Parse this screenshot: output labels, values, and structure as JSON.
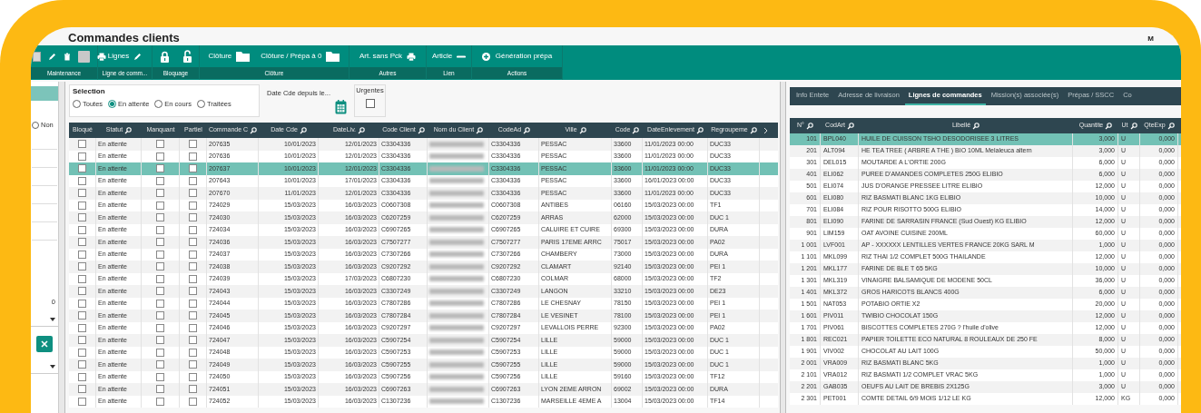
{
  "window": {
    "title": "Commandes clients",
    "user": "M"
  },
  "ribbon": {
    "groups": [
      {
        "label": "Maintenance"
      },
      {
        "label": "Ligne de comm...",
        "buttons": [
          {
            "label": "Lignes"
          }
        ]
      },
      {
        "label": "Bloquage"
      },
      {
        "label": "Clôture",
        "buttons": [
          {
            "label": "Clôture"
          },
          {
            "label": "Clôture / Prépa à 0"
          }
        ]
      },
      {
        "label": "Autres",
        "buttons": [
          {
            "label": "Art. sans Pck"
          }
        ]
      },
      {
        "label": "Lien",
        "buttons": [
          {
            "label": "Article"
          }
        ]
      },
      {
        "label": "Actions",
        "buttons": [
          {
            "label": "Génération prépa"
          }
        ]
      }
    ]
  },
  "sidebar": {
    "radio": {
      "label": "Non",
      "selected": false
    },
    "value": "0"
  },
  "selection": {
    "title": "Sélection",
    "options": [
      {
        "label": "Toutes",
        "selected": false
      },
      {
        "label": "En attente",
        "selected": true
      },
      {
        "label": "En cours",
        "selected": false
      },
      {
        "label": "Traitées",
        "selected": false
      }
    ]
  },
  "date_filter": {
    "label": "Date Cde depuis le..."
  },
  "urgent": {
    "label": "Urgentes",
    "checked": false
  },
  "orders": {
    "columns": [
      "Bloqué",
      "Statut",
      "Manquant",
      "Partiel",
      "Commande C",
      "Date Cde",
      "DateLiv.",
      "Code Client",
      "Nom du Client",
      "CodeAd",
      "Ville",
      "Code",
      "DateEnlevement",
      "Regroupeme"
    ],
    "rows": [
      {
        "statut": "En attente",
        "commande": "207635",
        "date_cde": "10/01/2023",
        "date_liv": "12/01/2023",
        "code_client": "C3304336",
        "code_ad": "C3304336",
        "ville": "PESSAC",
        "code_postal": "33600",
        "date_enlevement": "11/01/2023 00:00",
        "regroupement": "DUC33",
        "bloque": false,
        "manquant": false,
        "partiel": false,
        "selected": false
      },
      {
        "statut": "En attente",
        "commande": "207636",
        "date_cde": "10/01/2023",
        "date_liv": "12/01/2023",
        "code_client": "C3304336",
        "code_ad": "C3304336",
        "ville": "PESSAC",
        "code_postal": "33600",
        "date_enlevement": "11/01/2023 00:00",
        "regroupement": "DUC33",
        "bloque": false,
        "manquant": false,
        "partiel": false,
        "selected": false
      },
      {
        "statut": "En attente",
        "commande": "207637",
        "date_cde": "10/01/2023",
        "date_liv": "12/01/2023",
        "code_client": "C3304336",
        "code_ad": "C3304336",
        "ville": "PESSAC",
        "code_postal": "33600",
        "date_enlevement": "11/01/2023 00:00",
        "regroupement": "DUC33",
        "bloque": false,
        "manquant": false,
        "partiel": false,
        "selected": true
      },
      {
        "statut": "En attente",
        "commande": "207643",
        "date_cde": "10/01/2023",
        "date_liv": "17/01/2023",
        "code_client": "C3304336",
        "code_ad": "C3304336",
        "ville": "PESSAC",
        "code_postal": "33600",
        "date_enlevement": "16/01/2023 00:00",
        "regroupement": "DUC33",
        "bloque": false,
        "manquant": false,
        "partiel": false,
        "selected": false
      },
      {
        "statut": "En attente",
        "commande": "207670",
        "date_cde": "11/01/2023",
        "date_liv": "12/01/2023",
        "code_client": "C3304336",
        "code_ad": "C3304336",
        "ville": "PESSAC",
        "code_postal": "33600",
        "date_enlevement": "11/01/2023 00:00",
        "regroupement": "DUC33",
        "bloque": false,
        "manquant": false,
        "partiel": false,
        "selected": false
      },
      {
        "statut": "En attente",
        "commande": "724029",
        "date_cde": "15/03/2023",
        "date_liv": "16/03/2023",
        "code_client": "C0607308",
        "code_ad": "C0607308",
        "ville": "ANTIBES",
        "code_postal": "06160",
        "date_enlevement": "15/03/2023 00:00",
        "regroupement": "TF1",
        "bloque": false,
        "manquant": false,
        "partiel": false,
        "selected": false
      },
      {
        "statut": "En attente",
        "commande": "724030",
        "date_cde": "15/03/2023",
        "date_liv": "16/03/2023",
        "code_client": "C6207259",
        "code_ad": "C6207259",
        "ville": "ARRAS",
        "code_postal": "62000",
        "date_enlevement": "15/03/2023 00:00",
        "regroupement": "DUC 1",
        "bloque": false,
        "manquant": false,
        "partiel": false,
        "selected": false
      },
      {
        "statut": "En attente",
        "commande": "724034",
        "date_cde": "15/03/2023",
        "date_liv": "16/03/2023",
        "code_client": "C6907265",
        "code_ad": "C6907265",
        "ville": "CALUIRE ET CUIRE",
        "code_postal": "69300",
        "date_enlevement": "15/03/2023 00:00",
        "regroupement": "DURA",
        "bloque": false,
        "manquant": false,
        "partiel": false,
        "selected": false
      },
      {
        "statut": "En attente",
        "commande": "724036",
        "date_cde": "15/03/2023",
        "date_liv": "16/03/2023",
        "code_client": "C7507277",
        "code_ad": "C7507277",
        "ville": "PARIS 17EME ARRC",
        "code_postal": "75017",
        "date_enlevement": "15/03/2023 00:00",
        "regroupement": "PA02",
        "bloque": false,
        "manquant": false,
        "partiel": false,
        "selected": false
      },
      {
        "statut": "En attente",
        "commande": "724037",
        "date_cde": "15/03/2023",
        "date_liv": "16/03/2023",
        "code_client": "C7307266",
        "code_ad": "C7307266",
        "ville": "CHAMBERY",
        "code_postal": "73000",
        "date_enlevement": "15/03/2023 00:00",
        "regroupement": "DURA",
        "bloque": false,
        "manquant": false,
        "partiel": false,
        "selected": false
      },
      {
        "statut": "En attente",
        "commande": "724038",
        "date_cde": "15/03/2023",
        "date_liv": "16/03/2023",
        "code_client": "C9207292",
        "code_ad": "C9207292",
        "ville": "CLAMART",
        "code_postal": "92140",
        "date_enlevement": "15/03/2023 00:00",
        "regroupement": "PEI 1",
        "bloque": false,
        "manquant": false,
        "partiel": false,
        "selected": false
      },
      {
        "statut": "En attente",
        "commande": "724039",
        "date_cde": "15/03/2023",
        "date_liv": "17/03/2023",
        "code_client": "C6807230",
        "code_ad": "C6807230",
        "ville": "COLMAR",
        "code_postal": "68000",
        "date_enlevement": "15/03/2023 00:00",
        "regroupement": "TF2",
        "bloque": false,
        "manquant": false,
        "partiel": false,
        "selected": false
      },
      {
        "statut": "En attente",
        "commande": "724043",
        "date_cde": "15/03/2023",
        "date_liv": "16/03/2023",
        "code_client": "C3307249",
        "code_ad": "C3307249",
        "ville": "LANGON",
        "code_postal": "33210",
        "date_enlevement": "15/03/2023 00:00",
        "regroupement": "DE23",
        "bloque": false,
        "manquant": false,
        "partiel": false,
        "selected": false
      },
      {
        "statut": "En attente",
        "commande": "724044",
        "date_cde": "15/03/2023",
        "date_liv": "16/03/2023",
        "code_client": "C7807286",
        "code_ad": "C7807286",
        "ville": "LE CHESNAY",
        "code_postal": "78150",
        "date_enlevement": "15/03/2023 00:00",
        "regroupement": "PEI 1",
        "bloque": false,
        "manquant": false,
        "partiel": false,
        "selected": false
      },
      {
        "statut": "En attente",
        "commande": "724045",
        "date_cde": "15/03/2023",
        "date_liv": "16/03/2023",
        "code_client": "C7807284",
        "code_ad": "C7807284",
        "ville": "LE VESINET",
        "code_postal": "78100",
        "date_enlevement": "15/03/2023 00:00",
        "regroupement": "PEI 1",
        "bloque": false,
        "manquant": false,
        "partiel": false,
        "selected": false
      },
      {
        "statut": "En attente",
        "commande": "724046",
        "date_cde": "15/03/2023",
        "date_liv": "16/03/2023",
        "code_client": "C9207297",
        "code_ad": "C9207297",
        "ville": "LEVALLOIS PERRE",
        "code_postal": "92300",
        "date_enlevement": "15/03/2023 00:00",
        "regroupement": "PA02",
        "bloque": false,
        "manquant": false,
        "partiel": false,
        "selected": false
      },
      {
        "statut": "En attente",
        "commande": "724047",
        "date_cde": "15/03/2023",
        "date_liv": "16/03/2023",
        "code_client": "C5907254",
        "code_ad": "C5907254",
        "ville": "LILLE",
        "code_postal": "59000",
        "date_enlevement": "15/03/2023 00:00",
        "regroupement": "DUC 1",
        "bloque": false,
        "manquant": false,
        "partiel": false,
        "selected": false
      },
      {
        "statut": "En attente",
        "commande": "724048",
        "date_cde": "15/03/2023",
        "date_liv": "16/03/2023",
        "code_client": "C5907253",
        "code_ad": "C5907253",
        "ville": "LILLE",
        "code_postal": "59000",
        "date_enlevement": "15/03/2023 00:00",
        "regroupement": "DUC 1",
        "bloque": false,
        "manquant": false,
        "partiel": false,
        "selected": false
      },
      {
        "statut": "En attente",
        "commande": "724049",
        "date_cde": "15/03/2023",
        "date_liv": "16/03/2023",
        "code_client": "C5907255",
        "code_ad": "C5907255",
        "ville": "LILLE",
        "code_postal": "59000",
        "date_enlevement": "15/03/2023 00:00",
        "regroupement": "DUC 1",
        "bloque": false,
        "manquant": false,
        "partiel": false,
        "selected": false
      },
      {
        "statut": "En attente",
        "commande": "724050",
        "date_cde": "15/03/2023",
        "date_liv": "16/03/2023",
        "code_client": "C5907256",
        "code_ad": "C5907256",
        "ville": "LILLE",
        "code_postal": "59160",
        "date_enlevement": "15/03/2023 00:00",
        "regroupement": "TF12",
        "bloque": false,
        "manquant": false,
        "partiel": false,
        "selected": false
      },
      {
        "statut": "En attente",
        "commande": "724051",
        "date_cde": "15/03/2023",
        "date_liv": "16/03/2023",
        "code_client": "C6907263",
        "code_ad": "C6907263",
        "ville": "LYON 2EME ARRON",
        "code_postal": "69002",
        "date_enlevement": "15/03/2023 00:00",
        "regroupement": "DURA",
        "bloque": false,
        "manquant": false,
        "partiel": false,
        "selected": false
      },
      {
        "statut": "En attente",
        "commande": "724052",
        "date_cde": "15/03/2023",
        "date_liv": "16/03/2023",
        "code_client": "C1307236",
        "code_ad": "C1307236",
        "ville": "MARSEILLE 4EME A",
        "code_postal": "13004",
        "date_enlevement": "15/03/2023 00:00",
        "regroupement": "TF14",
        "bloque": false,
        "manquant": false,
        "partiel": false,
        "selected": false
      }
    ]
  },
  "detail": {
    "tabs": [
      {
        "label": "Info Entete",
        "selected": false
      },
      {
        "label": "Adresse de livraison",
        "selected": false
      },
      {
        "label": "Lignes de commandes",
        "selected": true
      },
      {
        "label": "Mission(s) associée(s)",
        "selected": false
      },
      {
        "label": "Prépas / SSCC",
        "selected": false
      },
      {
        "label": "Co",
        "selected": false
      }
    ],
    "columns": [
      "N°",
      "CodArt",
      "Libellé",
      "Quantite",
      "Ut",
      "QteExp"
    ],
    "rows": [
      {
        "n": "101",
        "code_article": "BPL040",
        "libelle": "HUILE DE CUISSON TSHO DESODORISEE 3 LITRES",
        "quantite": "3,000",
        "unite": "U",
        "qte_exp": "0,000",
        "selected": true
      },
      {
        "n": "201",
        "code_article": "ALT094",
        "libelle": "HE TEA TREE ( ARBRE A THE ) BIO 10ML  Melaleuca altern",
        "quantite": "3,000",
        "unite": "U",
        "qte_exp": "0,000",
        "selected": false
      },
      {
        "n": "301",
        "code_article": "DEL015",
        "libelle": "MOUTARDE A L'ORTIE 200G",
        "quantite": "6,000",
        "unite": "U",
        "qte_exp": "0,000",
        "selected": false
      },
      {
        "n": "401",
        "code_article": "ELI062",
        "libelle": "PUREE D'AMANDES COMPLETES 250G ELIBIO",
        "quantite": "6,000",
        "unite": "U",
        "qte_exp": "0,000",
        "selected": false
      },
      {
        "n": "501",
        "code_article": "ELI074",
        "libelle": "JUS D'ORANGE PRESSEE LITRE ELIBIO",
        "quantite": "12,000",
        "unite": "U",
        "qte_exp": "0,000",
        "selected": false
      },
      {
        "n": "601",
        "code_article": "ELI080",
        "libelle": "RIZ BASMATI BLANC 1KG ELIBIO",
        "quantite": "10,000",
        "unite": "U",
        "qte_exp": "0,000",
        "selected": false
      },
      {
        "n": "701",
        "code_article": "ELI084",
        "libelle": "RIZ POUR RISOTTO 500G ELIBIO",
        "quantite": "14,000",
        "unite": "U",
        "qte_exp": "0,000",
        "selected": false
      },
      {
        "n": "801",
        "code_article": "ELI090",
        "libelle": "FARINE DE SARRASIN FRANCE (Sud Ouest) KG ELIBIO",
        "quantite": "12,000",
        "unite": "U",
        "qte_exp": "0,000",
        "selected": false
      },
      {
        "n": "901",
        "code_article": "LIM159",
        "libelle": "OAT AVOINE CUISINE 200ML",
        "quantite": "60,000",
        "unite": "U",
        "qte_exp": "0,000",
        "selected": false
      },
      {
        "n": "1 001",
        "code_article": "LVF001",
        "libelle": "AP - XXXXXX LENTILLES VERTES FRANCE 20KG SARL M",
        "quantite": "1,000",
        "unite": "U",
        "qte_exp": "0,000",
        "selected": false
      },
      {
        "n": "1 101",
        "code_article": "MKL099",
        "libelle": "RIZ THAI 1/2 COMPLET 500G THAILANDE",
        "quantite": "12,000",
        "unite": "U",
        "qte_exp": "0,000",
        "selected": false
      },
      {
        "n": "1 201",
        "code_article": "MKL177",
        "libelle": "FARINE DE BLE T 65 5KG",
        "quantite": "10,000",
        "unite": "U",
        "qte_exp": "0,000",
        "selected": false
      },
      {
        "n": "1 301",
        "code_article": "MKL319",
        "libelle": "VINAIGRE BALSAMIQUE DE MODENE 50CL",
        "quantite": "36,000",
        "unite": "U",
        "qte_exp": "0,000",
        "selected": false
      },
      {
        "n": "1 401",
        "code_article": "MKL372",
        "libelle": "GROS HARICOTS BLANCS 400G",
        "quantite": "6,000",
        "unite": "U",
        "qte_exp": "0,000",
        "selected": false
      },
      {
        "n": "1 501",
        "code_article": "NAT053",
        "libelle": "POTABIO ORTIE  X2",
        "quantite": "20,000",
        "unite": "U",
        "qte_exp": "0,000",
        "selected": false
      },
      {
        "n": "1 601",
        "code_article": "PIV011",
        "libelle": "TWIBIO CHOCOLAT 150G",
        "quantite": "12,000",
        "unite": "U",
        "qte_exp": "0,000",
        "selected": false
      },
      {
        "n": "1 701",
        "code_article": "PIV061",
        "libelle": "BISCOTTES COMPLETES  270G  ? l'huile d'olive",
        "quantite": "12,000",
        "unite": "U",
        "qte_exp": "0,000",
        "selected": false
      },
      {
        "n": "1 801",
        "code_article": "REC021",
        "libelle": "PAPIER TOILETTE ECO NATURAL 8 ROULEAUX DE 250 FE",
        "quantite": "8,000",
        "unite": "U",
        "qte_exp": "0,000",
        "selected": false
      },
      {
        "n": "1 901",
        "code_article": "VIV002",
        "libelle": "CHOCOLAT AU LAIT 100G",
        "quantite": "50,000",
        "unite": "U",
        "qte_exp": "0,000",
        "selected": false
      },
      {
        "n": "2 001",
        "code_article": "VRA009",
        "libelle": "RIZ BASMATI BLANC 5KG",
        "quantite": "1,000",
        "unite": "U",
        "qte_exp": "0,000",
        "selected": false
      },
      {
        "n": "2 101",
        "code_article": "VRA012",
        "libelle": "RIZ BASMATI 1/2 COMPLET VRAC 5KG",
        "quantite": "1,000",
        "unite": "U",
        "qte_exp": "0,000",
        "selected": false
      },
      {
        "n": "2 201",
        "code_article": "GAB035",
        "libelle": "OEUFS AU LAIT DE BREBIS 2X125G",
        "quantite": "3,000",
        "unite": "U",
        "qte_exp": "0,000",
        "selected": false
      },
      {
        "n": "2 301",
        "code_article": "PET001",
        "libelle": "COMTE DETAIL 6/9 MOIS 1/12  LE KG",
        "quantite": "12,000",
        "unite": "KG",
        "qte_exp": "0,000",
        "selected": false
      }
    ]
  }
}
